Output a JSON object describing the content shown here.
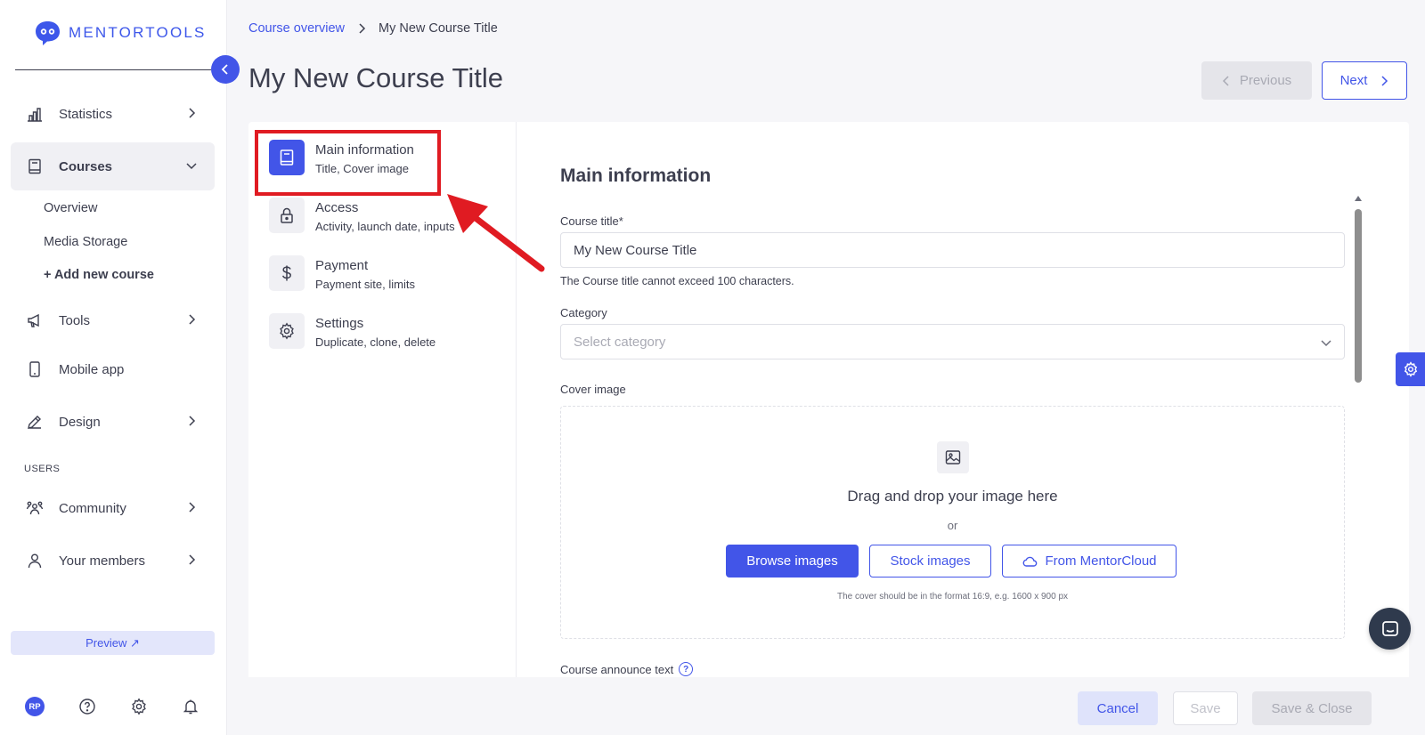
{
  "app": {
    "logo_text": "MENTORTOOLS",
    "accent_color": "#4255e8",
    "highlight_color": "#e01b22"
  },
  "sidebar": {
    "items": [
      {
        "label": "Statistics",
        "icon": "bar-chart-icon"
      },
      {
        "label": "Courses",
        "icon": "book-icon",
        "active": true
      },
      {
        "label": "Tools",
        "icon": "megaphone-icon"
      },
      {
        "label": "Mobile app",
        "icon": "phone-icon"
      },
      {
        "label": "Design",
        "icon": "pencil-icon"
      },
      {
        "label": "Community",
        "icon": "community-icon"
      },
      {
        "label": "Your members",
        "icon": "user-icon"
      }
    ],
    "courses_sub": [
      "Overview",
      "Media Storage",
      "+ Add new course"
    ],
    "section_users": "USERS",
    "preview_label": "Preview ↗",
    "avatar_initials": "RP"
  },
  "breadcrumb": {
    "parent": "Course overview",
    "current": "My New Course Title"
  },
  "page_title": "My New Course Title",
  "nav_buttons": {
    "previous": "Previous",
    "next": "Next"
  },
  "steps": [
    {
      "title": "Main information",
      "subtitle": "Title, Cover image",
      "icon": "book-icon"
    },
    {
      "title": "Access",
      "subtitle": "Activity, launch date, inputs",
      "icon": "lock-icon"
    },
    {
      "title": "Payment",
      "subtitle": "Payment site, limits",
      "icon": "dollar-icon"
    },
    {
      "title": "Settings",
      "subtitle": "Duplicate, clone, delete",
      "icon": "gear-icon"
    }
  ],
  "form": {
    "section_title": "Main information",
    "course_title_label": "Course title*",
    "course_title_value": "My New Course Title",
    "course_title_hint": "The Course title cannot exceed 100 characters.",
    "category_label": "Category",
    "category_placeholder": "Select category",
    "cover_label": "Cover image",
    "dropzone_text": "Drag and drop your image here",
    "dropzone_or": "or",
    "browse_label": "Browse images",
    "stock_label": "Stock images",
    "cloud_label": "From MentorCloud",
    "cover_note": "The cover should be in the format 16:9, e.g. 1600 x 900 px",
    "announce_label": "Course announce text",
    "announce_help": "?"
  },
  "footer": {
    "cancel": "Cancel",
    "save": "Save",
    "save_close": "Save & Close"
  }
}
